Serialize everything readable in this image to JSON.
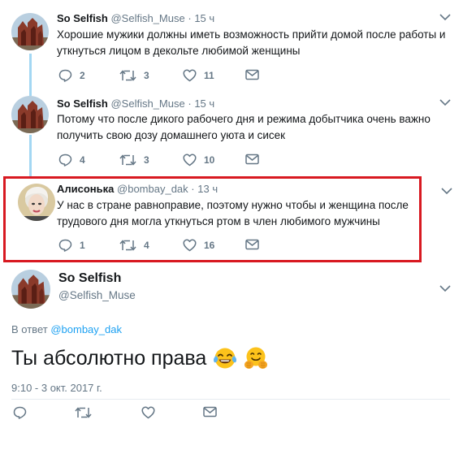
{
  "tweets": [
    {
      "name": "So Selfish",
      "handle": "@Selfish_Muse",
      "dot": "·",
      "time": "15 ч",
      "text": "Хорошие мужики должны иметь возможность прийти домой после работы и уткнуться лицом в декольте любимой женщины",
      "replies": "2",
      "retweets": "3",
      "likes": "11"
    },
    {
      "name": "So Selfish",
      "handle": "@Selfish_Muse",
      "dot": "·",
      "time": "15 ч",
      "text": "Потому что после дикого рабочего дня и режима добытчика очень важно получить свою дозу домашнего уюта и сисек",
      "replies": "4",
      "retweets": "3",
      "likes": "10"
    },
    {
      "name": "Алисонька",
      "handle": "@bombay_dak",
      "dot": "·",
      "time": "13 ч",
      "text": "У нас в стране равноправие, поэтому нужно чтобы и женщина после трудового дня могла уткнуться ртом в член любимого мужчины",
      "replies": "1",
      "retweets": "4",
      "likes": "16"
    }
  ],
  "main": {
    "name": "So Selfish",
    "handle": "@Selfish_Muse",
    "reply_prefix": "В ответ",
    "reply_handle": "@bombay_dak",
    "text": "Ты абсолютно права",
    "emojis": [
      "face-with-tears-of-joy",
      "hugging-face"
    ],
    "timestamp": "9:10 - 3 окт. 2017 г."
  },
  "colors": {
    "highlight_border": "#d81921",
    "thread_line": "#a3d7f3",
    "link": "#1da1f2",
    "secondary_text": "#657786"
  }
}
